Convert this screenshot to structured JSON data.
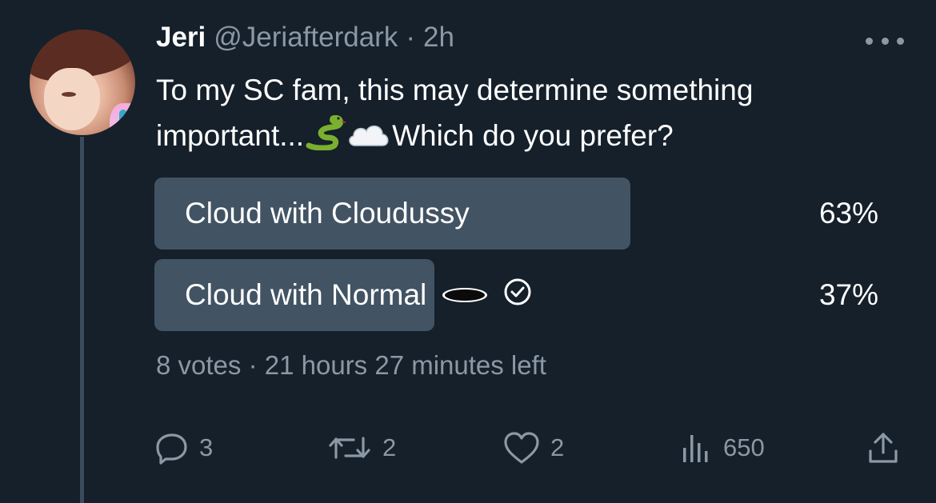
{
  "tweet": {
    "author_name": "Jeri",
    "author_handle": "@Jeriafterdark",
    "separator": "·",
    "time": "2h",
    "text_line1": "To my SC fam, this may determine something",
    "text_line2_start": "important...",
    "text_line2_end": "Which do you prefer?"
  },
  "poll": {
    "options": [
      {
        "label": "Cloud with Cloudussy",
        "percent_label": "63%",
        "percent": 63,
        "selected": false
      },
      {
        "label": "Cloud with Normal",
        "percent_label": "37%",
        "percent": 37,
        "selected": true
      }
    ],
    "votes": "8 votes",
    "separator": "·",
    "time_left": "21 hours 27 minutes left"
  },
  "actions": {
    "replies": "3",
    "retweets": "2",
    "likes": "2",
    "views": "650"
  },
  "colors": {
    "background": "#15202b",
    "poll_bar": "#425363",
    "secondary_text": "#8b98a5"
  }
}
